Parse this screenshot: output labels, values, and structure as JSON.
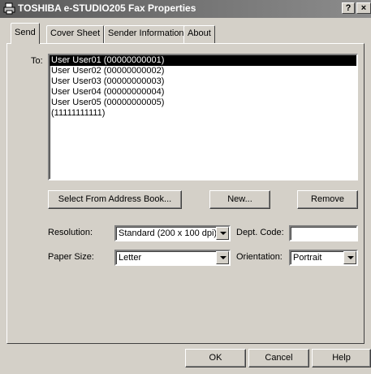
{
  "window": {
    "title": "TOSHIBA e-STUDIO205 Fax Properties",
    "help_label": "?",
    "close_label": "×"
  },
  "tabs": [
    {
      "label": "Send",
      "active": true
    },
    {
      "label": "Cover Sheet",
      "active": false
    },
    {
      "label": "Sender Information",
      "active": false
    },
    {
      "label": "About",
      "active": false
    }
  ],
  "send": {
    "to_label": "To:",
    "recipients": [
      "User User01 (00000000001)",
      "User User02 (00000000002)",
      "User User03 (00000000003)",
      "User User04 (00000000004)",
      "User User05 (00000000005)",
      "(11111111111)"
    ],
    "selected_index": 0,
    "address_book_label": "Select From Address Book...",
    "new_label": "New...",
    "remove_label": "Remove",
    "resolution_label": "Resolution:",
    "resolution_value": "Standard (200 x 100 dpi)",
    "dept_code_label": "Dept. Code:",
    "dept_code_value": "",
    "paper_size_label": "Paper Size:",
    "paper_size_value": "Letter",
    "orientation_label": "Orientation:",
    "orientation_value": "Portrait"
  },
  "footer": {
    "ok_label": "OK",
    "cancel_label": "Cancel",
    "help_label": "Help"
  }
}
